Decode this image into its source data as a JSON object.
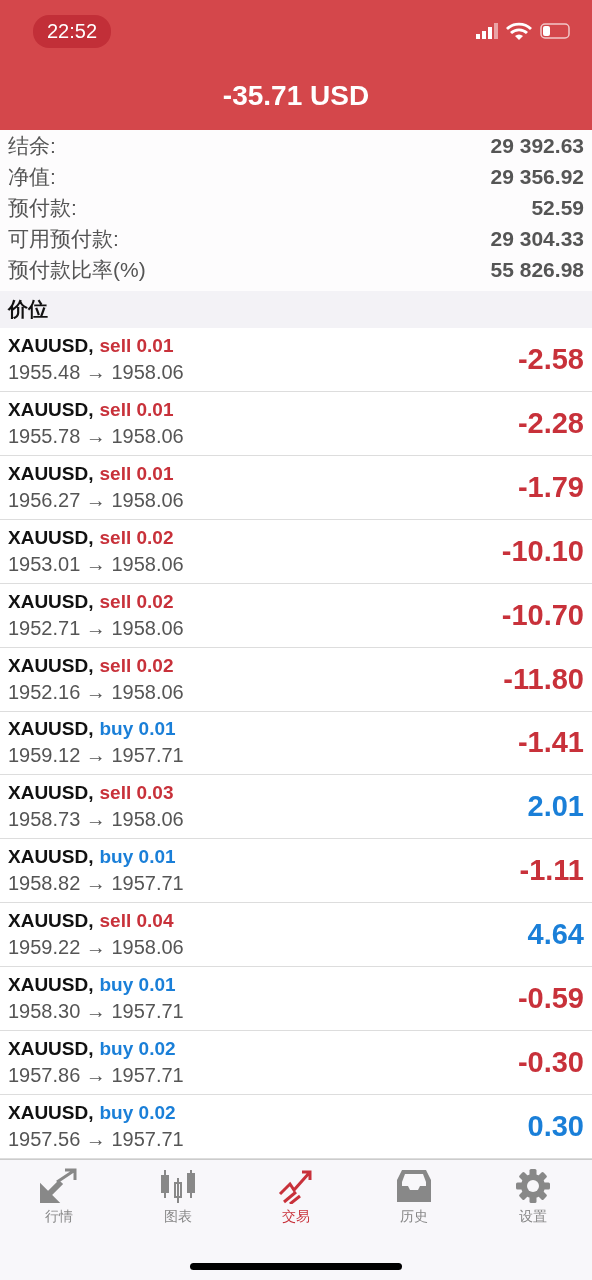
{
  "status_bar": {
    "time": "22:52"
  },
  "header": {
    "title": "-35.71 USD"
  },
  "summary": [
    {
      "label": "结余:",
      "value": "29 392.63"
    },
    {
      "label": "净值:",
      "value": "29 356.92"
    },
    {
      "label": "预付款:",
      "value": "52.59"
    },
    {
      "label": "可用预付款:",
      "value": "29 304.33"
    },
    {
      "label": "预付款比率(%)",
      "value": "55 826.98"
    }
  ],
  "section": {
    "title": "价位"
  },
  "positions": [
    {
      "symbol": "XAUUSD,",
      "buy": false,
      "order": "sell 0.01",
      "prices": "1955.48 → 1958.06",
      "profit": "-2.58",
      "loss": true
    },
    {
      "symbol": "XAUUSD,",
      "buy": false,
      "order": "sell 0.01",
      "prices": "1955.78 → 1958.06",
      "profit": "-2.28",
      "loss": true
    },
    {
      "symbol": "XAUUSD,",
      "buy": false,
      "order": "sell 0.01",
      "prices": "1956.27 → 1958.06",
      "profit": "-1.79",
      "loss": true
    },
    {
      "symbol": "XAUUSD,",
      "buy": false,
      "order": "sell 0.02",
      "prices": "1953.01 → 1958.06",
      "profit": "-10.10",
      "loss": true
    },
    {
      "symbol": "XAUUSD,",
      "buy": false,
      "order": "sell 0.02",
      "prices": "1952.71 → 1958.06",
      "profit": "-10.70",
      "loss": true
    },
    {
      "symbol": "XAUUSD,",
      "buy": false,
      "order": "sell 0.02",
      "prices": "1952.16 → 1958.06",
      "profit": "-11.80",
      "loss": true
    },
    {
      "symbol": "XAUUSD,",
      "buy": true,
      "order": "buy 0.01",
      "prices": "1959.12 → 1957.71",
      "profit": "-1.41",
      "loss": true
    },
    {
      "symbol": "XAUUSD,",
      "buy": false,
      "order": "sell 0.03",
      "prices": "1958.73 → 1958.06",
      "profit": "2.01",
      "loss": false
    },
    {
      "symbol": "XAUUSD,",
      "buy": true,
      "order": "buy 0.01",
      "prices": "1958.82 → 1957.71",
      "profit": "-1.11",
      "loss": true
    },
    {
      "symbol": "XAUUSD,",
      "buy": false,
      "order": "sell 0.04",
      "prices": "1959.22 → 1958.06",
      "profit": "4.64",
      "loss": false
    },
    {
      "symbol": "XAUUSD,",
      "buy": true,
      "order": "buy 0.01",
      "prices": "1958.30 → 1957.71",
      "profit": "-0.59",
      "loss": true
    },
    {
      "symbol": "XAUUSD,",
      "buy": true,
      "order": "buy 0.02",
      "prices": "1957.86 → 1957.71",
      "profit": "-0.30",
      "loss": true
    },
    {
      "symbol": "XAUUSD,",
      "buy": true,
      "order": "buy 0.02",
      "prices": "1957.56 → 1957.71",
      "profit": "0.30",
      "loss": false
    }
  ],
  "tab_bar": [
    {
      "label": "行情",
      "kind": "quotes",
      "selected": false
    },
    {
      "label": "图表",
      "kind": "chart",
      "selected": false
    },
    {
      "label": "交易",
      "kind": "trade",
      "selected": true
    },
    {
      "label": "历史",
      "kind": "history",
      "selected": false
    },
    {
      "label": "设置",
      "kind": "settings",
      "selected": false
    }
  ]
}
